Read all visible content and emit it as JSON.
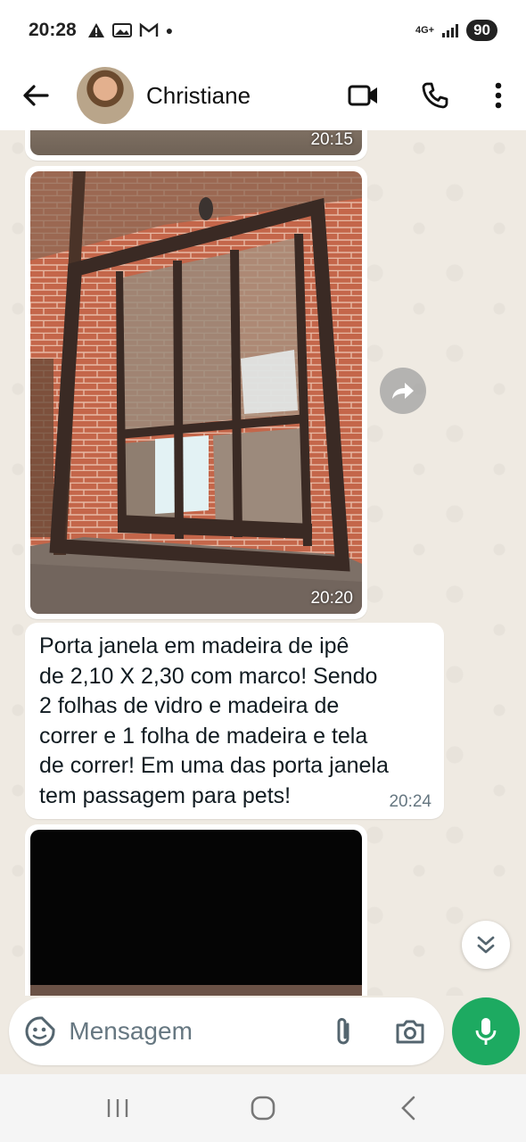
{
  "status_bar": {
    "time": "20:28",
    "notification_icons": [
      "alert-icon",
      "photo-icon",
      "gmail-icon",
      "dot-icon"
    ],
    "network": "4G+",
    "battery": "90"
  },
  "header": {
    "contact_name": "Christiane"
  },
  "messages": {
    "partial_image_time": "20:15",
    "image_time": "20:20",
    "text": "Porta janela em madeira de ipê\nde 2,10 X 2,30 com marco! Sendo\n2 folhas de vidro e madeira de\ncorrer e 1 folha de madeira e tela\nde correr! Em uma das porta janela\ntem passagem para pets!",
    "text_time": "20:24"
  },
  "input": {
    "placeholder": "Mensagem"
  },
  "colors": {
    "accent": "#1daa61",
    "chat_background": "#efeae2",
    "bubble": "#ffffff",
    "time_text": "#667781"
  }
}
